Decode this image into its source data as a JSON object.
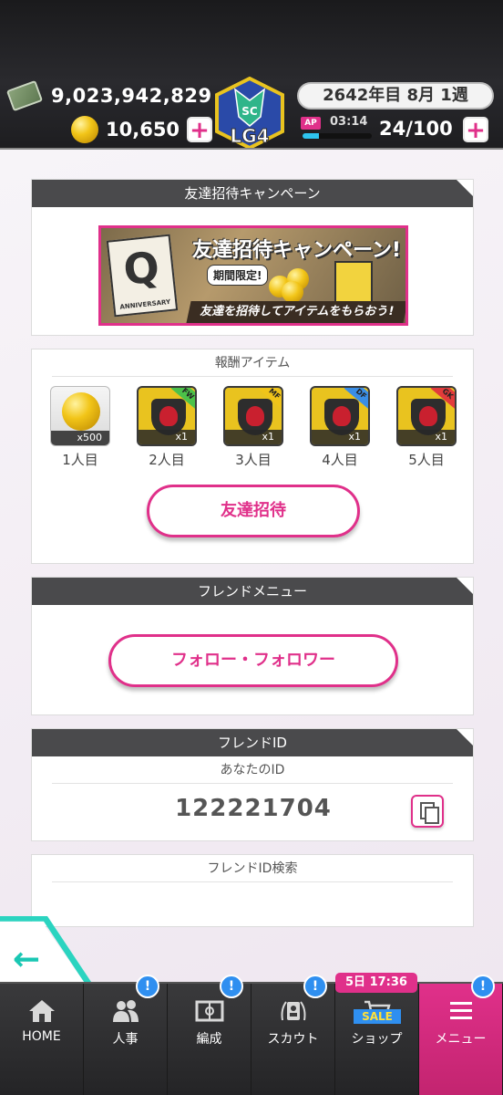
{
  "status": {
    "money": "9,023,942,829",
    "coins": "10,650",
    "date": "2642年目 8月 1週",
    "ap_label": "AP",
    "ap_timer": "03:14",
    "ap_value": "24/100",
    "ap_fill_fraction": 0.24,
    "plus": "+",
    "emblem_text": "LG4",
    "emblem_sub": "SC"
  },
  "campaign": {
    "header": "友達招待キャンペーン",
    "banner": {
      "letter": "Q",
      "anniversary": "ANNIVERSARY",
      "title": "友達招待キャンペーン!",
      "limited": "期間限定!",
      "footer": "友達を招待してアイテムをもらおう!"
    }
  },
  "rewards": {
    "header": "報酬アイテム",
    "items": [
      {
        "qty": "x500",
        "label": "1人目",
        "kind": "coin",
        "pos": ""
      },
      {
        "qty": "x1",
        "label": "2人目",
        "kind": "card",
        "pos": "FW"
      },
      {
        "qty": "x1",
        "label": "3人目",
        "kind": "card",
        "pos": "MF"
      },
      {
        "qty": "x1",
        "label": "4人目",
        "kind": "card",
        "pos": "DF"
      },
      {
        "qty": "x1",
        "label": "5人目",
        "kind": "card",
        "pos": "GK"
      }
    ],
    "invite_button": "友達招待"
  },
  "friend_menu": {
    "header": "フレンドメニュー",
    "follow_button": "フォロー・フォロワー"
  },
  "friend_id": {
    "header": "フレンドID",
    "your_id_label": "あなたのID",
    "value": "122221704",
    "search_label": "フレンドID検索"
  },
  "nav": {
    "items": [
      {
        "label": "HOME",
        "icon": "home-icon",
        "badge": ""
      },
      {
        "label": "人事",
        "icon": "people-icon",
        "badge": "!"
      },
      {
        "label": "編成",
        "icon": "field-icon",
        "badge": "!"
      },
      {
        "label": "スカウト",
        "icon": "scout-icon",
        "badge": "!"
      },
      {
        "label": "ショップ",
        "icon": "cart-icon",
        "badge": ""
      },
      {
        "label": "メニュー",
        "icon": "menu-icon",
        "badge": "!"
      }
    ],
    "sale_timer": "5日 17:36",
    "sale_tag": "SALE"
  },
  "colors": {
    "accent": "#e0308a",
    "header_bg": "#4a4a4c",
    "badge": "#2f8ff0",
    "back_arrow": "#19c7b3"
  }
}
